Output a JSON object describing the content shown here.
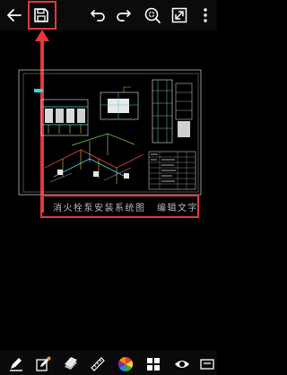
{
  "toolbar": {
    "icons": [
      "back-arrow-icon",
      "save-icon",
      "undo-icon",
      "redo-icon",
      "zoom-icon",
      "fit-screen-icon",
      "more-vertical-icon"
    ]
  },
  "drawing": {
    "title_text": "消火栓泵安装系统图",
    "edit_text": "编辑文字"
  },
  "bottom_toolbar": {
    "icons": [
      "markup-icon",
      "edit-text-icon",
      "layers-icon",
      "measure-icon",
      "color-wheel-icon",
      "blocks-icon",
      "view-eye-icon"
    ]
  },
  "colors": {
    "highlight": "#e8353c",
    "background": "#000000",
    "icon": "#ffffff"
  }
}
